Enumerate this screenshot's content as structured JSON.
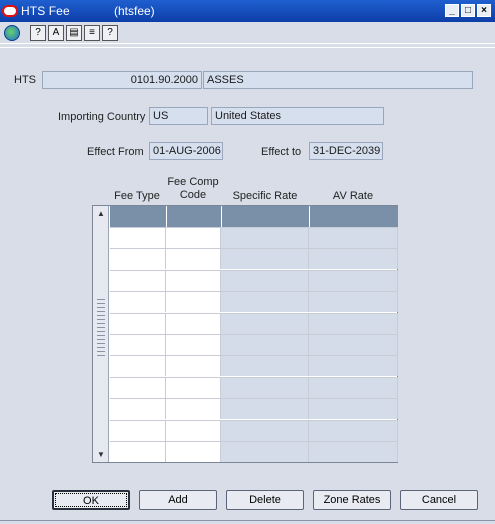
{
  "window": {
    "title": "HTS Fee",
    "form_name": "(htsfee)",
    "controls": [
      "_",
      "□",
      "×"
    ]
  },
  "toolbar": {
    "icons": [
      "globe-icon",
      "help-icon",
      "spell-icon",
      "clipboard-icon",
      "notes-icon",
      "question-icon"
    ],
    "glyphs": [
      "",
      "?",
      "A",
      "▤",
      "≡",
      "?"
    ]
  },
  "form": {
    "hts_label": "HTS",
    "hts_code": "0101.90.2000",
    "hts_desc": "ASSES",
    "country_label": "Importing Country",
    "country_code": "US",
    "country_name": "United States",
    "effect_from_label": "Effect From",
    "effect_from": "01-AUG-2006",
    "effect_to_label": "Effect to",
    "effect_to": "31-DEC-2039"
  },
  "table": {
    "columns": [
      "Fee Type",
      "Fee Comp\nCode",
      "Specific Rate",
      "AV Rate"
    ],
    "row_count": 11
  },
  "buttons": {
    "ok": "OK",
    "add": "Add",
    "delete": "Delete",
    "zone_rates": "Zone Rates",
    "cancel": "Cancel"
  }
}
